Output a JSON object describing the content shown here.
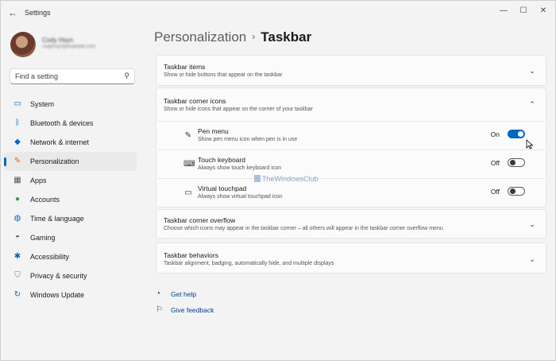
{
  "app": {
    "title": "Settings"
  },
  "window_controls": {
    "minimize": "—",
    "maximize": "☐",
    "close": "✕"
  },
  "user": {
    "name": "Cody Hsyn",
    "email": "codyhsyn@example.com"
  },
  "search": {
    "placeholder": "Find a setting"
  },
  "nav": {
    "items": [
      {
        "label": "System",
        "icon": "monitor-icon"
      },
      {
        "label": "Bluetooth & devices",
        "icon": "bluetooth-icon"
      },
      {
        "label": "Network & internet",
        "icon": "wifi-icon"
      },
      {
        "label": "Personalization",
        "icon": "brush-icon",
        "active": true
      },
      {
        "label": "Apps",
        "icon": "apps-icon"
      },
      {
        "label": "Accounts",
        "icon": "person-icon"
      },
      {
        "label": "Time & language",
        "icon": "globe-clock-icon"
      },
      {
        "label": "Gaming",
        "icon": "gamepad-icon"
      },
      {
        "label": "Accessibility",
        "icon": "accessibility-icon"
      },
      {
        "label": "Privacy & security",
        "icon": "shield-icon"
      },
      {
        "label": "Windows Update",
        "icon": "update-icon"
      }
    ]
  },
  "breadcrumb": {
    "parent": "Personalization",
    "separator": "›",
    "current": "Taskbar"
  },
  "sections": {
    "taskbar_items": {
      "title": "Taskbar items",
      "desc": "Show or hide buttons that appear on the taskbar"
    },
    "corner_icons": {
      "title": "Taskbar corner icons",
      "desc": "Show or hide icons that appear on the corner of your taskbar",
      "rows": [
        {
          "title": "Pen menu",
          "desc": "Show pen menu icon when pen is in use",
          "state": "On",
          "on": true,
          "icon": "pen-icon"
        },
        {
          "title": "Touch keyboard",
          "desc": "Always show touch keyboard icon",
          "state": "Off",
          "on": false,
          "icon": "keyboard-icon"
        },
        {
          "title": "Virtual touchpad",
          "desc": "Always show virtual touchpad icon",
          "state": "Off",
          "on": false,
          "icon": "touchpad-icon"
        }
      ]
    },
    "corner_overflow": {
      "title": "Taskbar corner overflow",
      "desc": "Choose which icons may appear in the taskbar corner – all others will appear in the taskbar corner overflow menu"
    },
    "behaviors": {
      "title": "Taskbar behaviors",
      "desc": "Taskbar alignment, badging, automatically hide, and multiple displays"
    }
  },
  "watermark": {
    "text": "TheWindowsClub"
  },
  "links": {
    "help": "Get help",
    "feedback": "Give feedback"
  },
  "colors": {
    "accent": "#0067c0",
    "background": "#f3f3f3",
    "card": "#fbfbfb",
    "link": "#003e92"
  }
}
